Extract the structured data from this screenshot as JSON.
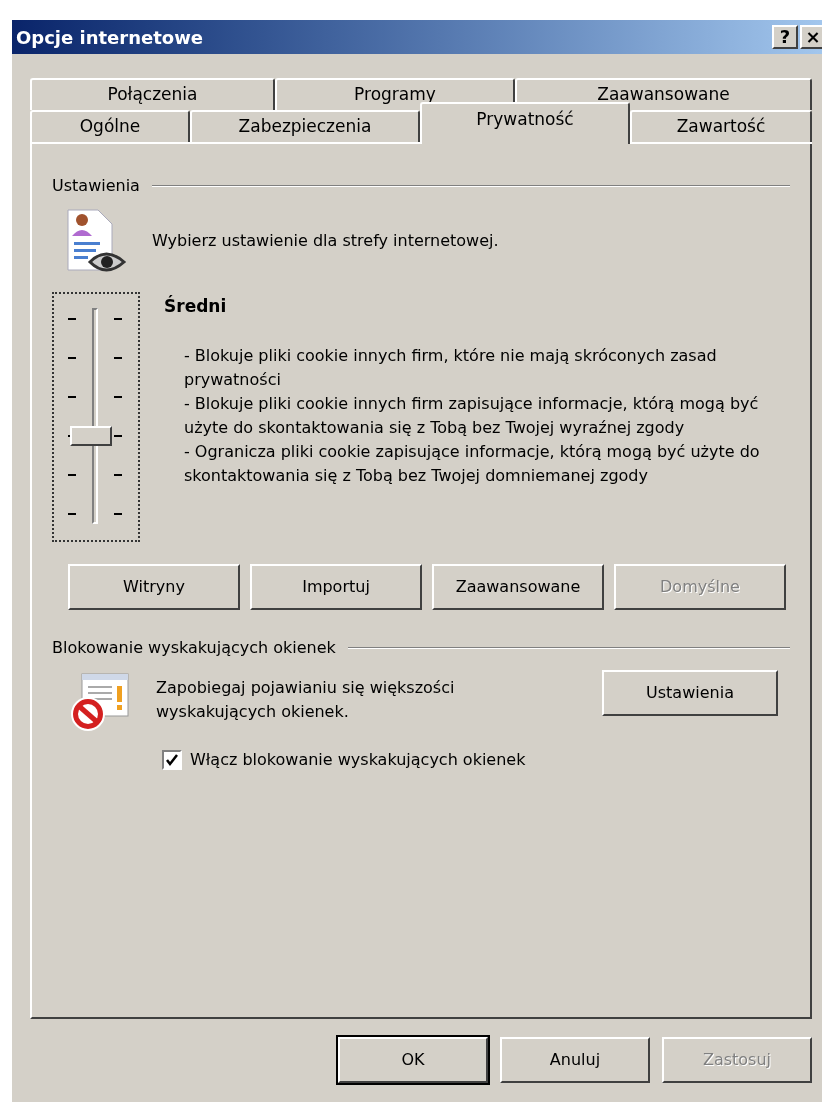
{
  "window": {
    "title": "Opcje internetowe",
    "title_buttons": [
      "?",
      "×"
    ]
  },
  "tab_rows": [
    [
      {
        "label": "Połączenia",
        "selected": false
      },
      {
        "label": "Programy",
        "selected": false
      },
      {
        "label": "Zaawansowane",
        "selected": false
      }
    ],
    [
      {
        "label": "Ogólne",
        "selected": false
      },
      {
        "label": "Zabezpieczenia",
        "selected": false
      },
      {
        "label": "Prywatność",
        "selected": true
      },
      {
        "label": "Zawartość",
        "selected": false
      }
    ]
  ],
  "settings": {
    "heading": "Ustawienia",
    "intro": "Wybierz ustawienie dla strefy internetowej.",
    "slider": {
      "level": 0.4
    },
    "level_name": "Średni",
    "description": [
      "- Blokuje pliki cookie innych firm, które nie mają skróconych zasad prywatności",
      "- Blokuje pliki cookie innych firm zapisujące informacje, którą mogą być użyte do skontaktowania się z Tobą bez Twojej wyraźnej zgody",
      "- Ogranicza pliki cookie zapisujące informacje, którą mogą być użyte do skontaktowania się z Tobą bez Twojej domniemanej zgody"
    ],
    "buttons": [
      {
        "label": "Witryny",
        "disabled": false
      },
      {
        "label": "Importuj",
        "disabled": false
      },
      {
        "label": "Zaawansowane",
        "disabled": false
      },
      {
        "label": "Domyślne",
        "disabled": true
      }
    ]
  },
  "popup_blocking": {
    "heading": "Blokowanie wyskakujących okienek",
    "text": "Zapobiegaj pojawianiu się większości wyskakujących okienek.",
    "button": "Ustawienia",
    "checkbox": {
      "label": "Włącz blokowanie wyskakujących okienek",
      "checked": true
    }
  },
  "footer_buttons": [
    {
      "label": "OK",
      "default": true,
      "disabled": false
    },
    {
      "label": "Anuluj",
      "default": false,
      "disabled": false
    },
    {
      "label": "Zastosuj",
      "default": false,
      "disabled": true
    }
  ]
}
